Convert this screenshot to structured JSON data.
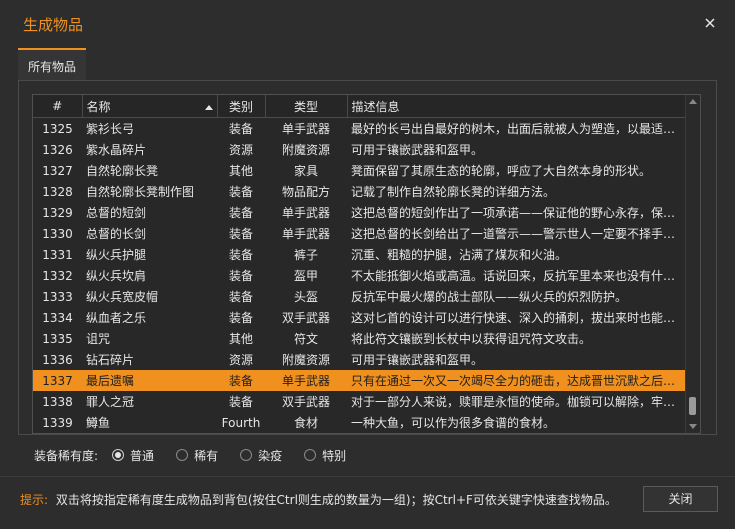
{
  "window": {
    "title": "生成物品"
  },
  "tabs": [
    {
      "label": "所有物品"
    }
  ],
  "table": {
    "columns": [
      "#",
      "名称",
      "类别",
      "类型",
      "描述信息"
    ],
    "sort_column": "名称",
    "selected_id": "1337",
    "rows": [
      {
        "id": "1325",
        "name": "紫衫长弓",
        "category": "装备",
        "type": "单手武器",
        "desc": "最好的长弓出自最好的树木，出面后就被人为塑造，以最适合…"
      },
      {
        "id": "1326",
        "name": "紫水晶碎片",
        "category": "资源",
        "type": "附魔资源",
        "desc": "可用于镶嵌武器和盔甲。"
      },
      {
        "id": "1327",
        "name": "自然轮廓长凳",
        "category": "其他",
        "type": "家具",
        "desc": "凳面保留了其原生态的轮廓，呼应了大自然本身的形状。"
      },
      {
        "id": "1328",
        "name": "自然轮廓长凳制作图",
        "category": "装备",
        "type": "物品配方",
        "desc": "记载了制作自然轮廓长凳的详细方法。"
      },
      {
        "id": "1329",
        "name": "总督的短剑",
        "category": "装备",
        "type": "单手武器",
        "desc": "这把总督的短剑作出了一项承诺——保证他的野心永存，保…"
      },
      {
        "id": "1330",
        "name": "总督的长剑",
        "category": "装备",
        "type": "单手武器",
        "desc": "这把总督的长剑给出了一道警示——警示世人一定要不择手…"
      },
      {
        "id": "1331",
        "name": "纵火兵护腿",
        "category": "装备",
        "type": "裤子",
        "desc": "沉重、粗糙的护腿，沾满了煤灰和火油。"
      },
      {
        "id": "1332",
        "name": "纵火兵坎肩",
        "category": "装备",
        "type": "盔甲",
        "desc": "不太能抵御火焰或高温。话说回来，反抗军里本来也没有什么…"
      },
      {
        "id": "1333",
        "name": "纵火兵宽皮帽",
        "category": "装备",
        "type": "头盔",
        "desc": "反抗军中最火爆的战士部队——纵火兵的炽烈防护。"
      },
      {
        "id": "1334",
        "name": "纵血者之乐",
        "category": "装备",
        "type": "双手武器",
        "desc": "这对匕首的设计可以进行快速、深入的捅刺，拔出来时也能高…"
      },
      {
        "id": "1335",
        "name": "诅咒",
        "category": "其他",
        "type": "符文",
        "desc": "将此符文镶嵌到长杖中以获得诅咒符文攻击。"
      },
      {
        "id": "1336",
        "name": "钻石碎片",
        "category": "资源",
        "type": "附魔资源",
        "desc": "可用于镶嵌武器和盔甲。"
      },
      {
        "id": "1337",
        "name": "最后遗嘱",
        "category": "装备",
        "type": "单手武器",
        "desc": "只有在通过一次又一次竭尽全力的砸击，达成晋世沉默之后，…"
      },
      {
        "id": "1338",
        "name": "罪人之冠",
        "category": "装备",
        "type": "双手武器",
        "desc": "对于一部分人来说，赎罪是永恒的使命。枷锁可以解除，牢门…"
      },
      {
        "id": "1339",
        "name": "鳟鱼",
        "category": "Fourth",
        "type": "食材",
        "desc": "一种大鱼，可以作为很多食谱的食材。"
      }
    ]
  },
  "rarity": {
    "label": "装备稀有度:",
    "options": [
      "普通",
      "稀有",
      "染疫",
      "特别"
    ],
    "selected": "普通"
  },
  "footer": {
    "hint_label": "提示:",
    "hint_text": "双击将按指定稀有度生成物品到背包(按住Ctrl则生成的数量为一组)；按Ctrl+F可依关键字快速查找物品。",
    "close_label": "关闭"
  },
  "colors": {
    "accent": "#f0901e",
    "background": "#2d2d2d",
    "text": "#e6e6e6"
  },
  "icons": {
    "close": "close-icon",
    "sort": "sort-ascending-icon",
    "scroll_up": "chevron-up-icon",
    "scroll_down": "chevron-down-icon"
  }
}
